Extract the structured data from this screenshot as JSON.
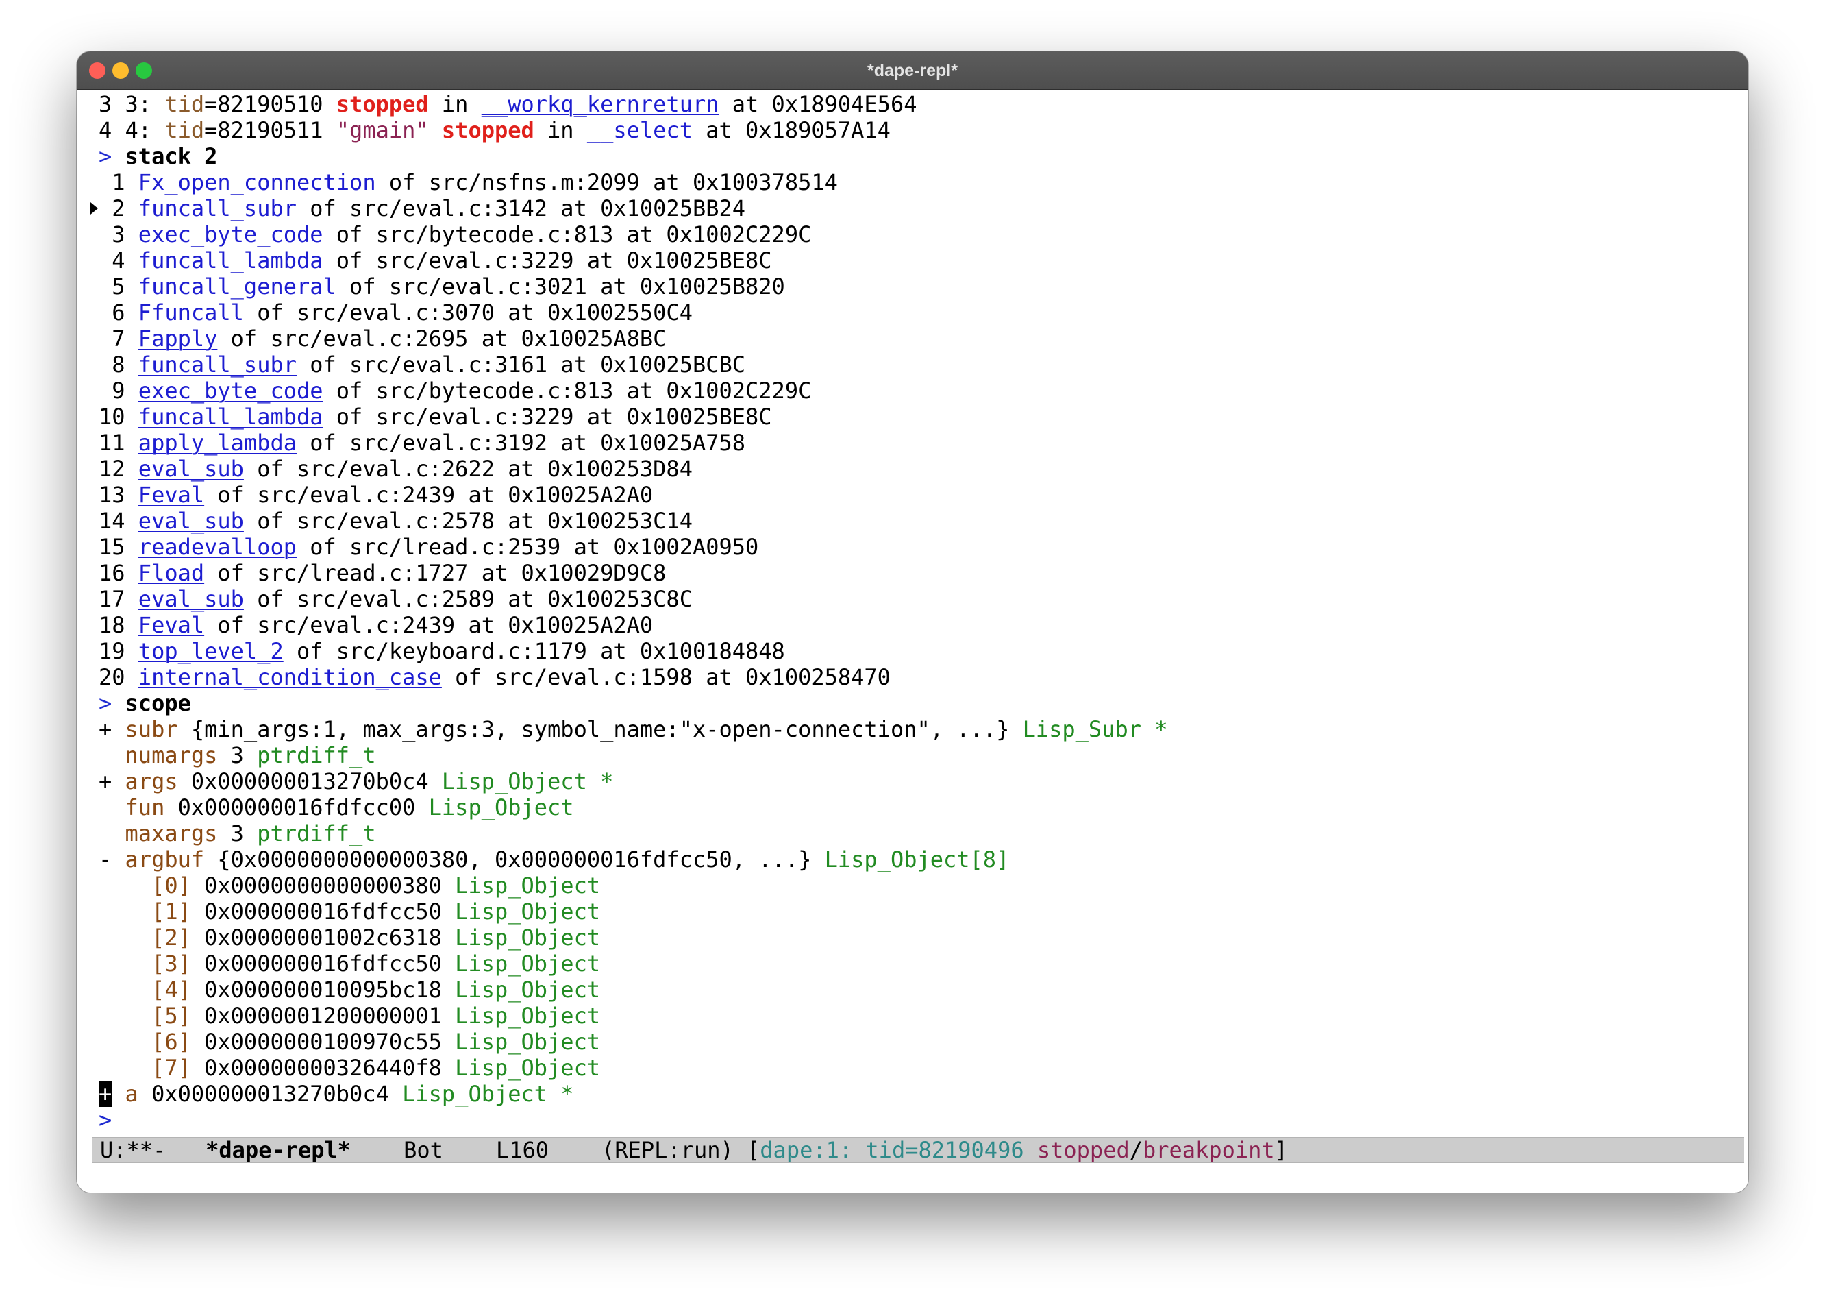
{
  "window": {
    "title": "*dape-repl*"
  },
  "threads": [
    {
      "num": "3",
      "label": "3:",
      "tid_key": "tid",
      "tid": "=82190510",
      "name": "",
      "state": "stopped",
      "in": "in",
      "func": "__workq_kernreturn",
      "at": "at 0x18904E564"
    },
    {
      "num": "4",
      "label": "4:",
      "tid_key": "tid",
      "tid": "=82190511",
      "name": "\"gmain\"",
      "state": "stopped",
      "in": "in",
      "func": "__select",
      "at": "at 0x189057A14"
    }
  ],
  "repl": {
    "prompt": ">",
    "stack_command": "stack 2",
    "scope_command": "scope"
  },
  "stack": [
    {
      "n": " 1",
      "func": "Fx_open_connection",
      "loc": "of src/nsfns.m:2099 at 0x100378514",
      "current": false
    },
    {
      "n": " 2",
      "func": "funcall_subr",
      "loc": "of src/eval.c:3142 at 0x10025BB24",
      "current": true
    },
    {
      "n": " 3",
      "func": "exec_byte_code",
      "loc": "of src/bytecode.c:813 at 0x1002C229C",
      "current": false
    },
    {
      "n": " 4",
      "func": "funcall_lambda",
      "loc": "of src/eval.c:3229 at 0x10025BE8C",
      "current": false
    },
    {
      "n": " 5",
      "func": "funcall_general",
      "loc": "of src/eval.c:3021 at 0x10025B820",
      "current": false
    },
    {
      "n": " 6",
      "func": "Ffuncall",
      "loc": "of src/eval.c:3070 at 0x1002550C4",
      "current": false
    },
    {
      "n": " 7",
      "func": "Fapply",
      "loc": "of src/eval.c:2695 at 0x10025A8BC",
      "current": false
    },
    {
      "n": " 8",
      "func": "funcall_subr",
      "loc": "of src/eval.c:3161 at 0x10025BCBC",
      "current": false
    },
    {
      "n": " 9",
      "func": "exec_byte_code",
      "loc": "of src/bytecode.c:813 at 0x1002C229C",
      "current": false
    },
    {
      "n": "10",
      "func": "funcall_lambda",
      "loc": "of src/eval.c:3229 at 0x10025BE8C",
      "current": false
    },
    {
      "n": "11",
      "func": "apply_lambda",
      "loc": "of src/eval.c:3192 at 0x10025A758",
      "current": false
    },
    {
      "n": "12",
      "func": "eval_sub",
      "loc": "of src/eval.c:2622 at 0x100253D84",
      "current": false
    },
    {
      "n": "13",
      "func": "Feval",
      "loc": "of src/eval.c:2439 at 0x10025A2A0",
      "current": false
    },
    {
      "n": "14",
      "func": "eval_sub",
      "loc": "of src/eval.c:2578 at 0x100253C14",
      "current": false
    },
    {
      "n": "15",
      "func": "readevalloop",
      "loc": "of src/lread.c:2539 at 0x1002A0950",
      "current": false
    },
    {
      "n": "16",
      "func": "Fload",
      "loc": "of src/lread.c:1727 at 0x10029D9C8",
      "current": false
    },
    {
      "n": "17",
      "func": "eval_sub",
      "loc": "of src/eval.c:2589 at 0x100253C8C",
      "current": false
    },
    {
      "n": "18",
      "func": "Feval",
      "loc": "of src/eval.c:2439 at 0x10025A2A0",
      "current": false
    },
    {
      "n": "19",
      "func": "top_level_2",
      "loc": "of src/keyboard.c:1179 at 0x100184848",
      "current": false
    },
    {
      "n": "20",
      "func": "internal_condition_case",
      "loc": "of src/eval.c:1598 at 0x100258470",
      "current": false
    }
  ],
  "scope": [
    {
      "marker": "+",
      "name": "subr",
      "value": " {min_args:1, max_args:3, symbol_name:\"x-open-connection\", ...} ",
      "type": "Lisp_Subr *"
    },
    {
      "marker": " ",
      "name": "numargs",
      "value": " 3 ",
      "type": "ptrdiff_t"
    },
    {
      "marker": "+",
      "name": "args",
      "value": " 0x000000013270b0c4 ",
      "type": "Lisp_Object *"
    },
    {
      "marker": " ",
      "name": "fun",
      "value": " 0x000000016fdfcc00 ",
      "type": "Lisp_Object"
    },
    {
      "marker": " ",
      "name": "maxargs",
      "value": " 3 ",
      "type": "ptrdiff_t"
    },
    {
      "marker": "-",
      "name": "argbuf",
      "value": " {0x0000000000000380, 0x000000016fdfcc50, ...} ",
      "type": "Lisp_Object[8]"
    }
  ],
  "argbuf": [
    {
      "idx": "[0]",
      "value": " 0x0000000000000380 ",
      "type": "Lisp_Object"
    },
    {
      "idx": "[1]",
      "value": " 0x000000016fdfcc50 ",
      "type": "Lisp_Object"
    },
    {
      "idx": "[2]",
      "value": " 0x00000001002c6318 ",
      "type": "Lisp_Object"
    },
    {
      "idx": "[3]",
      "value": " 0x000000016fdfcc50 ",
      "type": "Lisp_Object"
    },
    {
      "idx": "[4]",
      "value": " 0x000000010095bc18 ",
      "type": "Lisp_Object"
    },
    {
      "idx": "[5]",
      "value": " 0x0000001200000001 ",
      "type": "Lisp_Object"
    },
    {
      "idx": "[6]",
      "value": " 0x0000000100970c55 ",
      "type": "Lisp_Object"
    },
    {
      "idx": "[7]",
      "value": " 0x00000000326440f8 ",
      "type": "Lisp_Object"
    }
  ],
  "last_scope": {
    "marker": "+",
    "name": "a",
    "value": " 0x000000013270b0c4 ",
    "type": "Lisp_Object *"
  },
  "modeline": {
    "status": "U:**-",
    "buffer": "*dape-repl*",
    "position": "Bot",
    "line": "L160",
    "mode": "(REPL:run)",
    "open": "[",
    "dape": "dape",
    "sep": ":",
    "thread": "1: tid=82190496",
    "state": "stopped",
    "slash": "/",
    "reason": "breakpoint",
    "close": "]"
  }
}
